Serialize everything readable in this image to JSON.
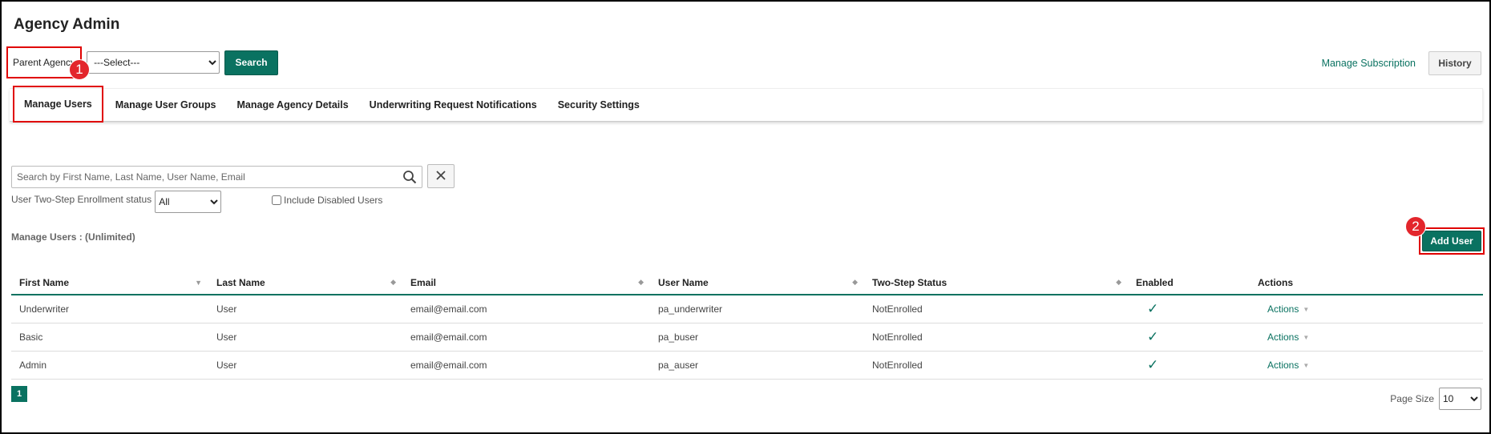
{
  "header": {
    "title": "Agency Admin"
  },
  "parent_agency": {
    "label": "Parent Agency",
    "selected": "---Select---",
    "search_label": "Search"
  },
  "top_right": {
    "manage_subscription": "Manage Subscription",
    "history": "History"
  },
  "tabs": [
    {
      "label": "Manage Users",
      "active": true
    },
    {
      "label": "Manage User Groups"
    },
    {
      "label": "Manage Agency Details"
    },
    {
      "label": "Underwriting Request Notifications"
    },
    {
      "label": "Security Settings"
    }
  ],
  "markers": {
    "one": "1",
    "two": "2"
  },
  "filters": {
    "search_placeholder": "Search by First Name, Last Name, User Name, Email",
    "enrollment_label": "User Two-Step Enrollment status",
    "enrollment_selected": "All",
    "include_disabled": "Include Disabled Users"
  },
  "manage_count": "Manage Users : (Unlimited)",
  "add_user": "Add User",
  "grid": {
    "columns": [
      "First Name",
      "Last Name",
      "Email",
      "User Name",
      "Two-Step Status",
      "Enabled",
      "Actions"
    ],
    "rows": [
      {
        "first": "Underwriter",
        "last": "User",
        "email": "email@email.com",
        "username": "pa_underwriter",
        "status": "NotEnrolled",
        "enabled": "✓",
        "actions": "Actions"
      },
      {
        "first": "Basic",
        "last": "User",
        "email": "email@email.com",
        "username": "pa_buser",
        "status": "NotEnrolled",
        "enabled": "✓",
        "actions": "Actions"
      },
      {
        "first": "Admin",
        "last": "User",
        "email": "email@email.com",
        "username": "pa_auser",
        "status": "NotEnrolled",
        "enabled": "✓",
        "actions": "Actions"
      }
    ]
  },
  "pager": {
    "current": "1",
    "page_size_label": "Page Size",
    "page_size": "10"
  },
  "colors": {
    "accent": "#0a7261",
    "highlight": "#e00000",
    "marker": "#e3262c"
  },
  "icons": {
    "search": "search-icon",
    "clear": "close-icon",
    "sort": "sort-icon",
    "enabled": "check-icon",
    "actions": "caret-down-icon"
  }
}
